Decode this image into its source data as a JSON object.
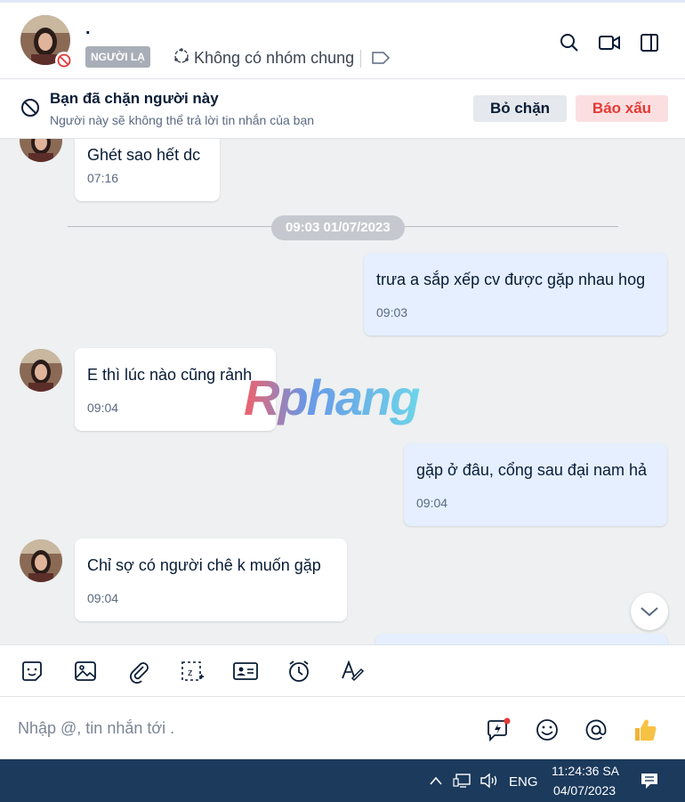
{
  "header": {
    "contact_name": ".",
    "stranger_tag": "NGƯỜI LẠ",
    "group_info": "Không có nhóm chung",
    "icons": [
      "search-icon",
      "video-call-icon",
      "sidebar-toggle-icon",
      "label-tag-icon",
      "group-icon",
      "blocked-icon"
    ]
  },
  "banner": {
    "title": "Bạn đã chặn người này",
    "subtitle": "Người này sẽ không thể trả lời tin nhắn của bạn",
    "unblock_label": "Bỏ chặn",
    "report_label": "Báo xấu"
  },
  "chat": {
    "date_separator": "09:03 01/07/2023",
    "watermark": "Rphang",
    "messages": [
      {
        "direction": "in",
        "text": "Ghét sao hết dc",
        "time": "07:16"
      },
      {
        "direction": "out",
        "text": "trưa a sắp xếp cv được gặp nhau hog",
        "time": "09:03"
      },
      {
        "direction": "in",
        "text": "E thì lúc nào cũng rảnh",
        "time": "09:04"
      },
      {
        "direction": "out",
        "text": "gặp ở đâu, cổng sau đại nam hả",
        "time": "09:04"
      },
      {
        "direction": "in",
        "text": "Chỉ sợ có người chê k muốn gặp",
        "time": "09:04"
      }
    ]
  },
  "toolbar": {
    "tools": [
      "sticker-icon",
      "image-icon",
      "attachment-icon",
      "screenshot-icon",
      "contact-card-icon",
      "reminder-icon",
      "text-format-icon"
    ]
  },
  "composer": {
    "placeholder": "Nhập @, tin nhắn tới .",
    "icons": [
      "quick-message-icon",
      "emoji-icon",
      "mention-icon",
      "like-icon"
    ]
  },
  "taskbar": {
    "language": "ENG",
    "time": "11:24:36 SA",
    "date": "04/07/2023"
  }
}
